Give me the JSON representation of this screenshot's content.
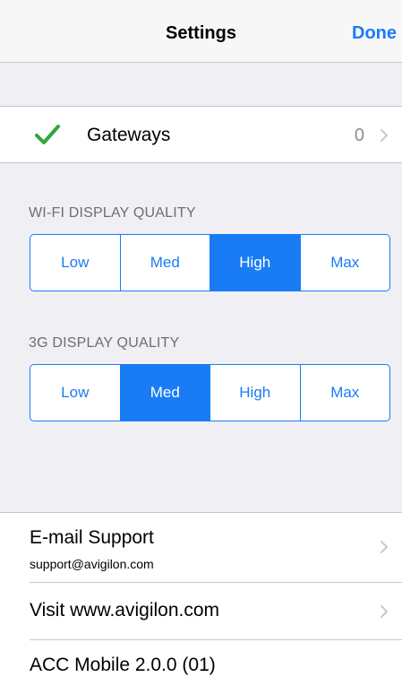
{
  "navbar": {
    "title": "Settings",
    "done_label": "Done"
  },
  "gateways": {
    "label": "Gateways",
    "count": "0",
    "checked": true,
    "icon": "checkmark-icon"
  },
  "wifi_quality": {
    "header": "WI-FI DISPLAY QUALITY",
    "options": [
      "Low",
      "Med",
      "High",
      "Max"
    ],
    "selected": "High"
  },
  "cellular_quality": {
    "header": "3G DISPLAY QUALITY",
    "options": [
      "Low",
      "Med",
      "High",
      "Max"
    ],
    "selected": "Med"
  },
  "links": {
    "email_support": {
      "title": "E-mail Support",
      "subtitle": "support@avigilon.com"
    },
    "visit_site": {
      "title": "Visit www.avigilon.com"
    },
    "version": {
      "title": "ACC Mobile 2.0.0 (01)"
    }
  },
  "colors": {
    "accent": "#1a7cf4",
    "check": "#2ea83a",
    "background": "#efeff4"
  }
}
